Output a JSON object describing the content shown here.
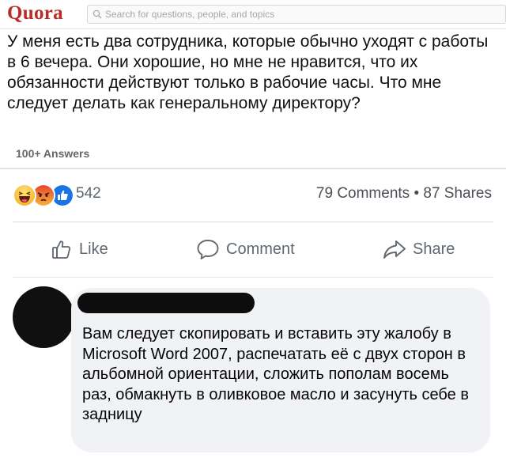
{
  "quora": {
    "logo": "Quora",
    "search_placeholder": "Search for questions, people, and topics",
    "question": "У меня есть два сотрудника, которые обычно уходят с работы в 6 вечера. Они хорошие, но мне не нравится, что их обязанности действуют только в рабочие часы. Что мне следует делать как генеральному директору?",
    "answers_count": "100+ Answers",
    "brand_color": "#b92b27"
  },
  "post": {
    "reactions": [
      "haha-icon",
      "angry-icon",
      "like-icon"
    ],
    "reaction_count": "542",
    "stats": "79 Comments • 87 Shares",
    "actions": {
      "like": "Like",
      "comment": "Comment",
      "share": "Share"
    }
  },
  "comment": {
    "text": "Вам следует скопировать и вставить эту жалобу в Microsoft Word 2007, распечатать её с двух сторон в альбомной ориентации, сложить пополам восемь раз, обмакнуть в оливковое масло и засунуть себе в задницу"
  }
}
